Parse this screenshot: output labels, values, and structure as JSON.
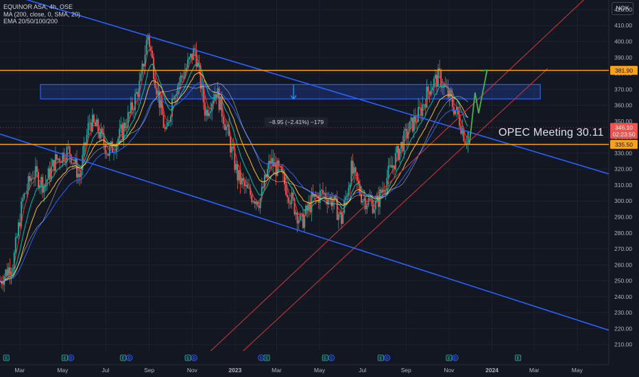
{
  "legend": {
    "title": "EQUINOR ASA, 4h, OSE",
    "ma": "MA (200, close, 0, SMA, 20)",
    "ema": "EMA 20/50/100/200"
  },
  "currency": "NOK",
  "annotation": "OPEC Meeting 30.11",
  "measure_label": "−8.95 (−2.41%) −179",
  "colors": {
    "background": "#131722",
    "grid": "#1e222d",
    "candle_up": "#26a69a",
    "candle_down": "#ef5350",
    "blue_line": "#2962ff",
    "orange_line": "#f7a21b",
    "red_channel": "#c5363a",
    "green_arrow": "#4caf50",
    "ma200": "#f0f0f0"
  },
  "chart_data": {
    "type": "candlestick",
    "title": "EQUINOR ASA, 4h, OSE",
    "currency": "NOK",
    "ylim": [
      206,
      426
    ],
    "y_ticks": [
      210,
      220,
      230,
      240,
      250,
      260,
      270,
      280,
      290,
      300,
      310,
      320,
      330,
      340,
      350,
      360,
      370,
      380,
      390,
      400,
      410,
      420
    ],
    "y_tick_labels": [
      "210.00",
      "220.00",
      "230.00",
      "240.00",
      "250.00",
      "260.00",
      "270.00",
      "280.00",
      "290.00",
      "300.00",
      "310.00",
      "320.00",
      "330.00",
      "340.00",
      "350.00",
      "360.00",
      "370.00",
      "380.00",
      "390.00",
      "400.00",
      "410.00",
      "420.00"
    ],
    "x_ticks": [
      "Mar",
      "May",
      "Jul",
      "Sep",
      "Nov",
      "2023",
      "Mar",
      "May",
      "Jul",
      "Sep",
      "Nov",
      "2024",
      "Mar",
      "May"
    ],
    "x_ticks_bold": [
      false,
      false,
      false,
      false,
      false,
      true,
      false,
      false,
      false,
      false,
      false,
      true,
      false,
      false
    ],
    "x_range": [
      "2022-02-01",
      "2024-06-15"
    ],
    "price_path": [
      [
        "2022-02-01",
        250
      ],
      [
        "2022-02-20",
        262
      ],
      [
        "2022-03-05",
        300
      ],
      [
        "2022-03-20",
        318
      ],
      [
        "2022-04-05",
        310
      ],
      [
        "2022-04-20",
        325
      ],
      [
        "2022-05-10",
        332
      ],
      [
        "2022-05-25",
        315
      ],
      [
        "2022-06-08",
        350
      ],
      [
        "2022-06-20",
        345
      ],
      [
        "2022-07-05",
        330
      ],
      [
        "2022-07-20",
        340
      ],
      [
        "2022-08-05",
        355
      ],
      [
        "2022-08-20",
        375
      ],
      [
        "2022-08-30",
        405
      ],
      [
        "2022-09-10",
        375
      ],
      [
        "2022-09-25",
        340
      ],
      [
        "2022-10-05",
        368
      ],
      [
        "2022-10-20",
        380
      ],
      [
        "2022-11-05",
        395
      ],
      [
        "2022-11-20",
        355
      ],
      [
        "2022-12-05",
        370
      ],
      [
        "2022-12-20",
        345
      ],
      [
        "2023-01-05",
        315
      ],
      [
        "2023-01-20",
        305
      ],
      [
        "2023-02-05",
        300
      ],
      [
        "2023-02-20",
        325
      ],
      [
        "2023-03-05",
        318
      ],
      [
        "2023-03-20",
        303
      ],
      [
        "2023-04-05",
        286
      ],
      [
        "2023-04-20",
        300
      ],
      [
        "2023-05-05",
        305
      ],
      [
        "2023-05-20",
        300
      ],
      [
        "2023-06-01",
        288
      ],
      [
        "2023-06-15",
        320
      ],
      [
        "2023-07-01",
        302
      ],
      [
        "2023-07-20",
        297
      ],
      [
        "2023-08-05",
        315
      ],
      [
        "2023-08-20",
        330
      ],
      [
        "2023-09-05",
        345
      ],
      [
        "2023-09-20",
        355
      ],
      [
        "2023-10-05",
        372
      ],
      [
        "2023-10-18",
        378
      ],
      [
        "2023-11-01",
        365
      ],
      [
        "2023-11-15",
        352
      ],
      [
        "2023-11-25",
        338
      ],
      [
        "2023-11-30",
        346.1
      ]
    ],
    "horizontal_levels": [
      381.9,
      335.5
    ],
    "zone": [
      373,
      364
    ],
    "last_price": 346.1,
    "last_price_label": "346.10",
    "countdown_label": "02:23:50",
    "level_labels": [
      "381.90",
      "335.50"
    ],
    "trendlines": [
      {
        "from": [
          "2022-02-10",
          430
        ],
        "to": [
          "2024-06-15",
          317
        ]
      },
      {
        "from": [
          "2022-02-01",
          342
        ],
        "to": [
          "2024-06-15",
          219
        ]
      },
      {
        "from": [
          "2022-11-25",
          205
        ],
        "to": [
          "2024-05-15",
          428
        ]
      },
      {
        "from": [
          "2023-01-10",
          205
        ],
        "to": [
          "2024-03-20",
          383
        ]
      }
    ],
    "projection": [
      [
        "2023-11-30",
        336
      ],
      [
        "2023-12-08",
        368
      ],
      [
        "2023-12-13",
        355
      ],
      [
        "2023-12-25",
        382
      ]
    ],
    "moving_averages": [
      "MA (200, close, 0, SMA, 20)",
      "EMA 20",
      "EMA 50",
      "EMA 100",
      "EMA 200"
    ],
    "event_markers": [
      {
        "date": "2022-02-10",
        "icons": [
          "E"
        ]
      },
      {
        "date": "2022-05-04",
        "icons": [
          "E",
          "D"
        ]
      },
      {
        "date": "2022-07-26",
        "icons": [
          "E",
          "D"
        ]
      },
      {
        "date": "2022-10-26",
        "icons": [
          "E",
          "D"
        ]
      },
      {
        "date": "2023-02-07",
        "icons": [
          "D"
        ]
      },
      {
        "date": "2023-02-15",
        "icons": [
          "E"
        ]
      },
      {
        "date": "2023-05-09",
        "icons": [
          "E",
          "D"
        ]
      },
      {
        "date": "2023-07-27",
        "icons": [
          "E",
          "D"
        ]
      },
      {
        "date": "2023-11-01",
        "icons": [
          "E",
          "D"
        ]
      },
      {
        "date": "2024-02-07",
        "icons": [
          "E"
        ]
      }
    ]
  }
}
